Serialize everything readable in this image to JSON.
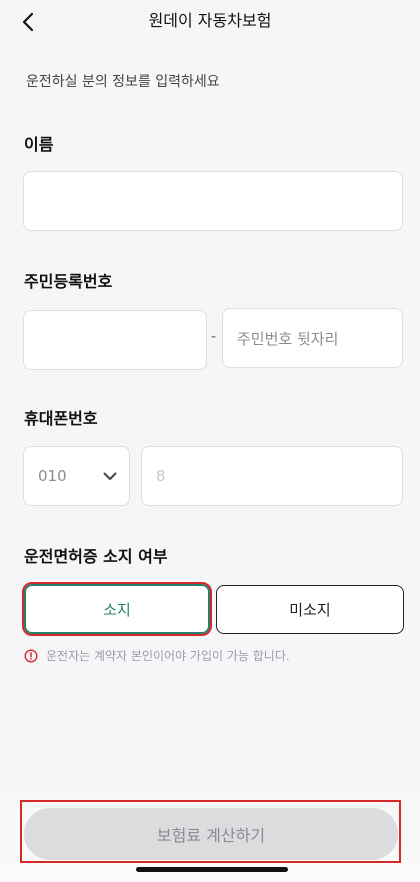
{
  "header": {
    "title": "원데이 자동차보험"
  },
  "subtitle": "운전하실 분의 정보를 입력하세요",
  "name_section": {
    "label": "이름",
    "value": ""
  },
  "rrn_section": {
    "label": "주민등록번호",
    "front_value": "",
    "separator": "-",
    "back_placeholder": "주민번호 뒷자리"
  },
  "phone_section": {
    "label": "휴대폰번호",
    "prefix_selected": "010",
    "number_placeholder": "8"
  },
  "license_section": {
    "label": "운전면허증 소지 여부",
    "option_have": "소지",
    "option_not_have": "미소지",
    "selected": "소지",
    "notice": "운전자는 계약자 본인이어야 가입이 가능 합니다."
  },
  "cta": {
    "label": "보험료 계산하기",
    "enabled": false
  },
  "colors": {
    "accent": "#23826f",
    "highlight": "#d62a2a",
    "disabled_bg": "#dcdcdf"
  }
}
